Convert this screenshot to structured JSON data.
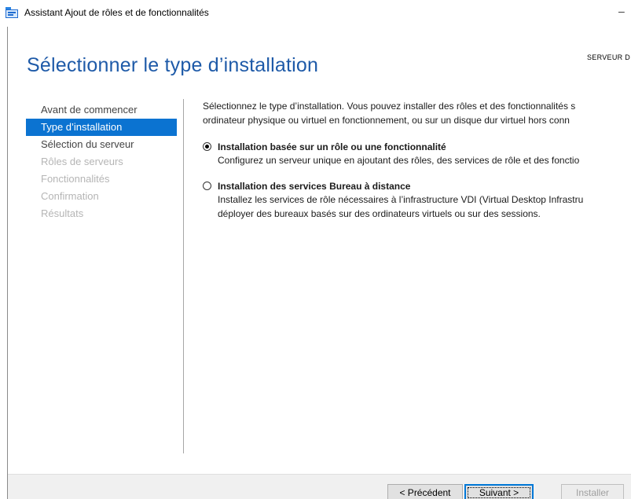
{
  "window": {
    "title": "Assistant Ajout de rôles et de fonctionnalités",
    "minimize_glyph": "–"
  },
  "header": {
    "page_title": "Sélectionner le type d’installation",
    "server_label": "SERVEUR D"
  },
  "nav": {
    "items": [
      {
        "label": "Avant de commencer",
        "state": "normal"
      },
      {
        "label": "Type d’installation",
        "state": "active"
      },
      {
        "label": "Sélection du serveur",
        "state": "normal"
      },
      {
        "label": "Rôles de serveurs",
        "state": "disabled"
      },
      {
        "label": "Fonctionnalités",
        "state": "disabled"
      },
      {
        "label": "Confirmation",
        "state": "disabled"
      },
      {
        "label": "Résultats",
        "state": "disabled"
      }
    ]
  },
  "content": {
    "intro_line1": "Sélectionnez le type d’installation. Vous pouvez installer des rôles et des fonctionnalités s",
    "intro_line2": "ordinateur physique ou virtuel en fonctionnement, ou sur un disque dur virtuel hors conn",
    "options": [
      {
        "title": "Installation basée sur un rôle ou une fonctionnalité",
        "desc_line1": "Configurez un serveur unique en ajoutant des rôles, des services de rôle et des fonctio",
        "desc_line2": "",
        "selected": true
      },
      {
        "title": "Installation des services Bureau à distance",
        "desc_line1": "Installez les services de rôle nécessaires à l’infrastructure VDI (Virtual Desktop Infrastru",
        "desc_line2": "déployer des bureaux basés sur des ordinateurs virtuels ou sur des sessions.",
        "selected": false
      }
    ]
  },
  "footer": {
    "previous_label": "< Précédent",
    "next_label": "Suivant >",
    "install_label": "Installer"
  },
  "colors": {
    "accent": "#0b73d1",
    "title_blue": "#1e5aa8",
    "disabled_text": "#b5b5b5"
  }
}
